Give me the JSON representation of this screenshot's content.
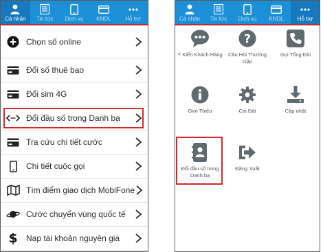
{
  "left": {
    "tabs": [
      {
        "label": "Cá nhân",
        "icon": "person-icon"
      },
      {
        "label": "Tin tức",
        "icon": "news-icon"
      },
      {
        "label": "Dịch vụ",
        "icon": "phone-icon"
      },
      {
        "label": "KNDL",
        "icon": "card-icon"
      },
      {
        "label": "Hỗ trợ",
        "icon": "more-icon"
      }
    ],
    "menu": [
      {
        "label": "Chọn số online",
        "icon": "plus-circle-icon"
      },
      {
        "label": "Đổi số thuê bao",
        "icon": "card-icon"
      },
      {
        "label": "Đổi sim 4G",
        "icon": "card-icon"
      },
      {
        "label": "Đổi đầu số trong Danh bạ",
        "icon": "code-icon"
      },
      {
        "label": "Tra cứu chi tiết cước",
        "icon": "card-icon"
      },
      {
        "label": "Chi tiết cuộc gọi",
        "icon": "mobile-icon"
      },
      {
        "label": "Tìm điểm giao dịch MobiFone",
        "icon": "map-icon"
      },
      {
        "label": "Cước chuyển vùng quốc tế",
        "icon": "planet-icon"
      },
      {
        "label": "Nạp tài khoản nguyên giá",
        "icon": "dollar-icon"
      }
    ]
  },
  "right": {
    "tabs": [
      {
        "label": "Cá nhân",
        "icon": "person-icon"
      },
      {
        "label": "Tin tức",
        "icon": "news-icon"
      },
      {
        "label": "Dịch vụ",
        "icon": "phone-icon"
      },
      {
        "label": "KNDL",
        "icon": "card-icon"
      },
      {
        "label": "Hỗ trợ",
        "icon": "more-icon"
      }
    ],
    "grid": [
      {
        "label": "Ý Kiến Khách Hàng",
        "icon": "chat-bubble-icon"
      },
      {
        "label": "Câu Hỏi Thường Gặp",
        "icon": "question-icon"
      },
      {
        "label": "Gọi Tổng Đài",
        "icon": "call-icon"
      },
      {
        "label": "Giới Thiệu",
        "icon": "info-icon"
      },
      {
        "label": "Cài Đặt",
        "icon": "gear-icon"
      },
      {
        "label": "Cập nhật",
        "icon": "download-icon"
      },
      {
        "label": "Đổi đầu số trong Danh bạ",
        "icon": "contacts-icon"
      },
      {
        "label": "Đăng Xuất",
        "icon": "logout-icon"
      }
    ]
  },
  "colors": {
    "tabbar": "#1c8fd6",
    "highlight": "#d1272b",
    "icon_gray": "#5f6a70"
  }
}
